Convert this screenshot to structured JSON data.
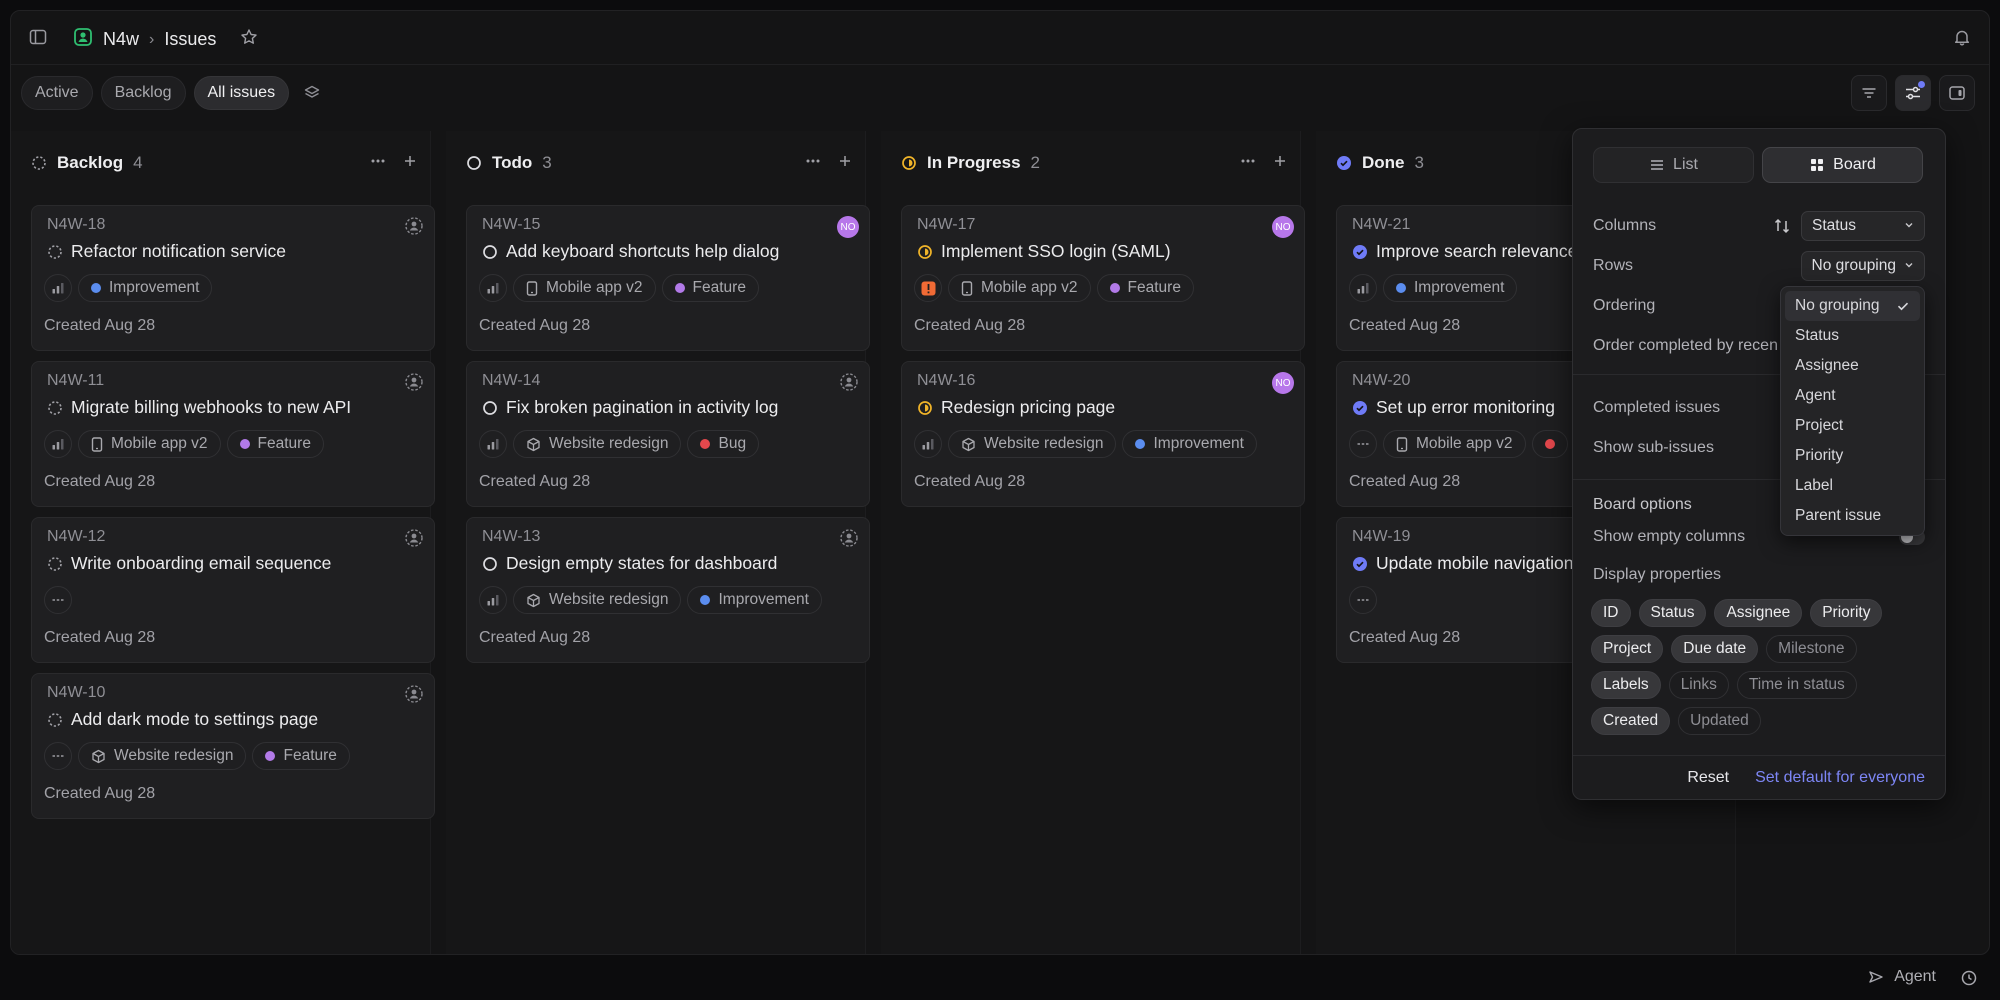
{
  "breadcrumb": {
    "workspace": "N4w",
    "page": "Issues"
  },
  "filters": [
    "Active",
    "Backlog",
    "All issues"
  ],
  "active_filter": "All issues",
  "columns": [
    {
      "title": "Backlog",
      "count": "4",
      "status_icon": "dashed-circle-icon",
      "status_color": "#a0a0a6",
      "cards": [
        {
          "id": "N4W-18",
          "title": "Refactor notification service",
          "tags": [
            {
              "icon": "priority-icon"
            },
            {
              "label": "Improvement",
              "dot": "#5b8def"
            }
          ],
          "created": "Created Aug 28",
          "avatar": ""
        },
        {
          "id": "N4W-11",
          "title": "Migrate billing webhooks to new API",
          "tags": [
            {
              "icon": "priority-icon"
            },
            {
              "label": "Mobile app v2",
              "icon": "phone-icon"
            },
            {
              "label": "Feature",
              "dot": "#b27ae8"
            }
          ],
          "created": "Created Aug 28",
          "avatar": ""
        },
        {
          "id": "N4W-12",
          "title": "Write onboarding email sequence",
          "tags": [
            {
              "icon": "no-priority-icon"
            }
          ],
          "created": "Created Aug 28",
          "avatar": ""
        },
        {
          "id": "N4W-10",
          "title": "Add dark mode to settings page",
          "tags": [
            {
              "icon": "no-priority-icon"
            },
            {
              "label": "Website redesign",
              "icon": "cube-icon"
            },
            {
              "label": "Feature",
              "dot": "#b27ae8"
            }
          ],
          "created": "Created Aug 28",
          "avatar": ""
        }
      ]
    },
    {
      "title": "Todo",
      "count": "3",
      "status_icon": "circle-icon",
      "status_color": "#dcdce0",
      "cards": [
        {
          "id": "N4W-15",
          "title": "Add keyboard shortcuts help dialog",
          "tags": [
            {
              "icon": "priority-icon"
            },
            {
              "label": "Mobile app v2",
              "icon": "phone-icon"
            },
            {
              "label": "Feature",
              "dot": "#b27ae8"
            }
          ],
          "created": "Created Aug 28",
          "avatar": "NO"
        },
        {
          "id": "N4W-14",
          "title": "Fix broken pagination in activity log",
          "tags": [
            {
              "icon": "priority-icon"
            },
            {
              "label": "Website redesign",
              "icon": "cube-icon"
            },
            {
              "label": "Bug",
              "dot": "#e5484d"
            }
          ],
          "created": "Created Aug 28",
          "avatar": ""
        },
        {
          "id": "N4W-13",
          "title": "Design empty states for dashboard",
          "tags": [
            {
              "icon": "priority-icon"
            },
            {
              "label": "Website redesign",
              "icon": "cube-icon"
            },
            {
              "label": "Improvement",
              "dot": "#5b8def"
            }
          ],
          "created": "Created Aug 28",
          "avatar": ""
        }
      ]
    },
    {
      "title": "In Progress",
      "count": "2",
      "status_icon": "half-circle-icon",
      "status_color": "#f0b429",
      "cards": [
        {
          "id": "N4W-17",
          "title": "Implement SSO login (SAML)",
          "tags": [
            {
              "icon": "urgent-icon"
            },
            {
              "label": "Mobile app v2",
              "icon": "phone-icon"
            },
            {
              "label": "Feature",
              "dot": "#b27ae8"
            }
          ],
          "created": "Created Aug 28",
          "avatar": "NO"
        },
        {
          "id": "N4W-16",
          "title": "Redesign pricing page",
          "tags": [
            {
              "icon": "priority-icon"
            },
            {
              "label": "Website redesign",
              "icon": "cube-icon"
            },
            {
              "label": "Improvement",
              "dot": "#5b8def"
            }
          ],
          "created": "Created Aug 28",
          "avatar": "NO"
        }
      ]
    },
    {
      "title": "Done",
      "count": "3",
      "status_icon": "check-circle-icon",
      "status_color": "#6f7bf7",
      "cards": [
        {
          "id": "N4W-21",
          "title": "Improve search relevance",
          "tags": [
            {
              "icon": "priority-icon"
            },
            {
              "label": "Improvement",
              "dot": "#5b8def"
            }
          ],
          "created": "Created Aug 28",
          "avatar": ""
        },
        {
          "id": "N4W-20",
          "title": "Set up error monitoring",
          "tags": [
            {
              "icon": "no-priority-icon"
            },
            {
              "label": "Mobile app v2",
              "icon": "phone-icon"
            },
            {
              "label": "",
              "dot": "#e5484d"
            }
          ],
          "created": "Created Aug 28",
          "avatar": ""
        },
        {
          "id": "N4W-19",
          "title": "Update mobile navigation",
          "tags": [
            {
              "icon": "no-priority-icon"
            }
          ],
          "created": "Created Aug 28",
          "avatar": ""
        }
      ]
    }
  ],
  "panel": {
    "layout_list": "List",
    "layout_board": "Board",
    "columns_label": "Columns",
    "columns_value": "Status",
    "rows_label": "Rows",
    "rows_value": "No grouping",
    "ordering_label": "Ordering",
    "order_completed_label": "Order completed by recen",
    "completed_issues_label": "Completed issues",
    "show_sub_issues_label": "Show sub-issues",
    "board_options_label": "Board options",
    "show_empty_columns_label": "Show empty columns",
    "display_properties_label": "Display properties",
    "properties": [
      {
        "label": "ID",
        "on": true
      },
      {
        "label": "Status",
        "on": true
      },
      {
        "label": "Assignee",
        "on": true
      },
      {
        "label": "Priority",
        "on": true
      },
      {
        "label": "Project",
        "on": true
      },
      {
        "label": "Due date",
        "on": true
      },
      {
        "label": "Milestone",
        "on": false
      },
      {
        "label": "Labels",
        "on": true
      },
      {
        "label": "Links",
        "on": false
      },
      {
        "label": "Time in status",
        "on": false
      },
      {
        "label": "Created",
        "on": true
      },
      {
        "label": "Updated",
        "on": false
      }
    ],
    "reset_label": "Reset",
    "set_default_label": "Set default for everyone"
  },
  "rows_dropdown": {
    "options": [
      "No grouping",
      "Status",
      "Assignee",
      "Agent",
      "Project",
      "Priority",
      "Label",
      "Parent issue"
    ],
    "selected": "No grouping"
  },
  "footer": {
    "agent_label": "Agent"
  },
  "colors": {
    "accent": "#6f7bf7",
    "link": "#7d86f5"
  }
}
